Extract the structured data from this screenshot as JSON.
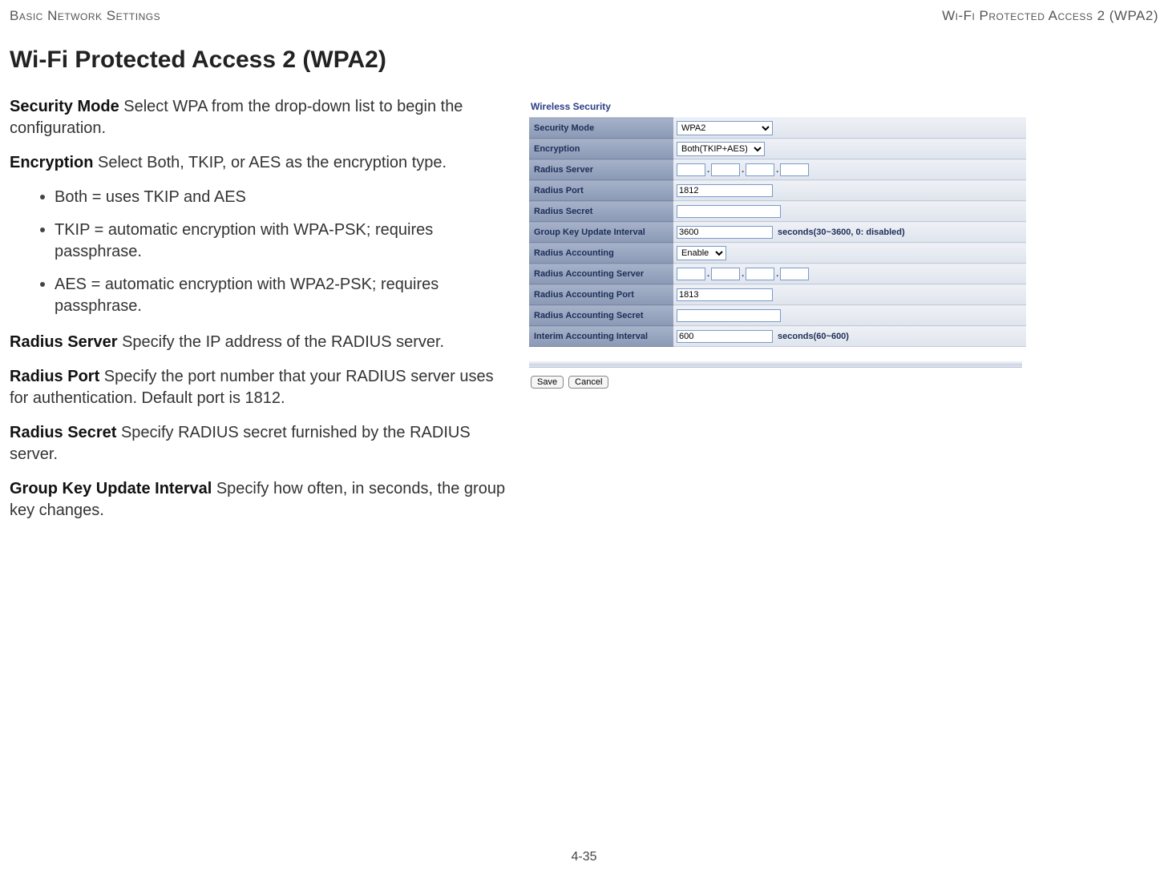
{
  "header": {
    "left": "Basic Network Settings",
    "right": "Wi-Fi Protected Access 2 (WPA2)"
  },
  "title": "Wi-Fi Protected Access 2 (WPA2)",
  "defs": {
    "security_mode": {
      "term": "Security Mode",
      "text": "  Select WPA from the drop-down list to begin the configuration."
    },
    "encryption": {
      "term": "Encryption",
      "text": "  Select Both, TKIP, or AES as the encryption type."
    },
    "bullets": [
      "Both = uses TKIP and AES",
      "TKIP = automatic encryption with WPA-PSK; requires passphrase.",
      "AES = automatic encryption with WPA2-PSK; requires passphrase."
    ],
    "radius_server": {
      "term": "Radius Server",
      "text": "  Specify the IP address of the RADIUS server."
    },
    "radius_port": {
      "term": "Radius Port",
      "text": "  Specify the port number that your RADIUS server uses for authentication. Default port is 1812."
    },
    "radius_secret": {
      "term": "Radius Secret",
      "text": "  Specify RADIUS secret furnished by the RADIUS server."
    },
    "group_key": {
      "term": "Group Key Update Interval",
      "text": "  Specify how often, in seconds, the group key changes."
    }
  },
  "panel": {
    "title": "Wireless Security",
    "rows": {
      "security_mode": {
        "label": "Security Mode",
        "value": "WPA2"
      },
      "encryption": {
        "label": "Encryption",
        "value": "Both(TKIP+AES)"
      },
      "radius_server": {
        "label": "Radius Server",
        "octets": [
          "",
          "",
          "",
          ""
        ]
      },
      "radius_port": {
        "label": "Radius Port",
        "value": "1812"
      },
      "radius_secret": {
        "label": "Radius Secret",
        "value": ""
      },
      "group_key": {
        "label": "Group Key Update Interval",
        "value": "3600",
        "hint": "seconds(30~3600, 0: disabled)"
      },
      "radius_acct": {
        "label": "Radius Accounting",
        "value": "Enable"
      },
      "radius_acct_server": {
        "label": "Radius Accounting Server",
        "octets": [
          "",
          "",
          "",
          ""
        ]
      },
      "radius_acct_port": {
        "label": "Radius Accounting Port",
        "value": "1813"
      },
      "radius_acct_secret": {
        "label": "Radius Accounting Secret",
        "value": ""
      },
      "interim": {
        "label": "Interim Accounting Interval",
        "value": "600",
        "hint": "seconds(60~600)"
      }
    },
    "buttons": {
      "save": "Save",
      "cancel": "Cancel"
    }
  },
  "footer": "4-35"
}
